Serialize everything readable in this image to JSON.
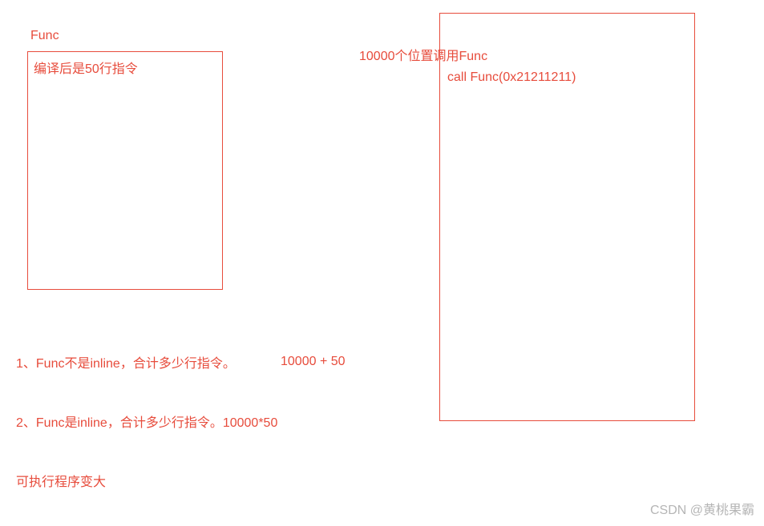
{
  "left": {
    "label": "Func",
    "box_text": "编译后是50行指令"
  },
  "right": {
    "title": "10000个位置调用Func",
    "call_line": "call  Func(0x21211211)"
  },
  "points": {
    "p1_text": "1、Func不是inline，合计多少行指令。",
    "p1_calc": "10000  +  50",
    "p2_text": "2、Func是inline，合计多少行指令。10000*50",
    "p3_text": "可执行程序变大"
  },
  "watermark": "CSDN @黄桃果霸"
}
